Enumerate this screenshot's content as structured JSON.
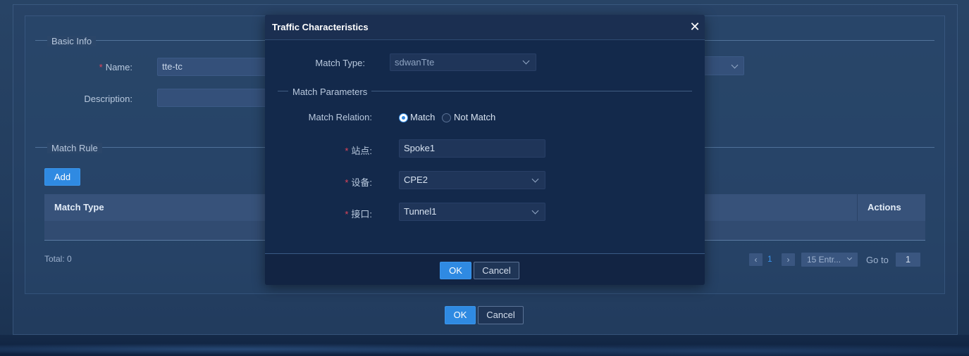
{
  "background_form": {
    "basic_info_legend": "Basic Info",
    "name_label": "Name",
    "name_value": "tte-tc",
    "description_label": "Description",
    "description_value": "",
    "match_rule_legend": "Match Rule",
    "add_button": "Add",
    "table": {
      "columns": [
        "Match Type",
        "Actions"
      ],
      "rows": []
    },
    "total_text": "Total: 0",
    "pagination": {
      "current_page": "1",
      "page_size": "15 Entr...",
      "goto_label": "Go to",
      "goto_value": "1"
    },
    "ok_button": "OK",
    "cancel_button": "Cancel"
  },
  "modal": {
    "title": "Traffic Characteristics",
    "close_glyph": "✕",
    "match_type_label": "Match Type:",
    "match_type_value": "sdwanTte",
    "match_parameters_legend": "Match Parameters",
    "match_relation_label": "Match Relation:",
    "match_relation_options": [
      "Match",
      "Not Match"
    ],
    "match_relation_selected": "Match",
    "site_label": "站点:",
    "site_value": "Spoke1",
    "device_label": "设备:",
    "device_value": "CPE2",
    "interface_label": "接口:",
    "interface_value": "Tunnel1",
    "ok_button": "OK",
    "cancel_button": "Cancel"
  },
  "colors": {
    "primary": "#2f8ae2",
    "required": "#e0455a",
    "modal_bg": "#13294b",
    "page_bg": "#284466"
  }
}
